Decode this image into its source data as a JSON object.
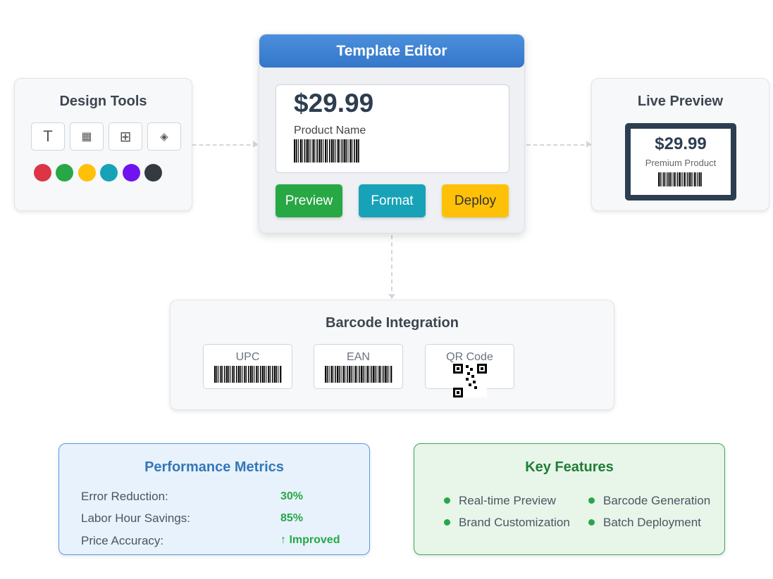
{
  "design_tools": {
    "title": "Design Tools",
    "tools": [
      {
        "name": "text-tool",
        "glyph": "T"
      },
      {
        "name": "grid-tool",
        "glyph": "▦"
      },
      {
        "name": "layout-tool",
        "glyph": "⊞"
      },
      {
        "name": "shape-tool",
        "glyph": "◈"
      }
    ],
    "swatches": [
      "#dc3545",
      "#28a745",
      "#ffc107",
      "#17a2b8",
      "#6f14ef",
      "#343a40"
    ]
  },
  "editor": {
    "title": "Template Editor",
    "price": "$29.99",
    "product_name": "Product Name",
    "buttons": {
      "preview": "Preview",
      "format": "Format",
      "deploy": "Deploy"
    },
    "colors": {
      "preview": "#28a745",
      "format": "#17a2b8",
      "deploy": "#ffc107"
    }
  },
  "live_preview": {
    "title": "Live Preview",
    "price": "$29.99",
    "product": "Premium Product"
  },
  "barcode": {
    "title": "Barcode Integration",
    "types": [
      "UPC",
      "EAN",
      "QR Code"
    ]
  },
  "metrics": {
    "title": "Performance Metrics",
    "rows": [
      {
        "label": "Error Reduction:",
        "value": "30%"
      },
      {
        "label": "Labor Hour Savings:",
        "value": "85%"
      },
      {
        "label": "Price Accuracy:",
        "value": "↑ Improved"
      }
    ]
  },
  "features": {
    "title": "Key Features",
    "items": [
      "Real-time Preview",
      "Barcode Generation",
      "Brand Customization",
      "Batch Deployment"
    ]
  }
}
